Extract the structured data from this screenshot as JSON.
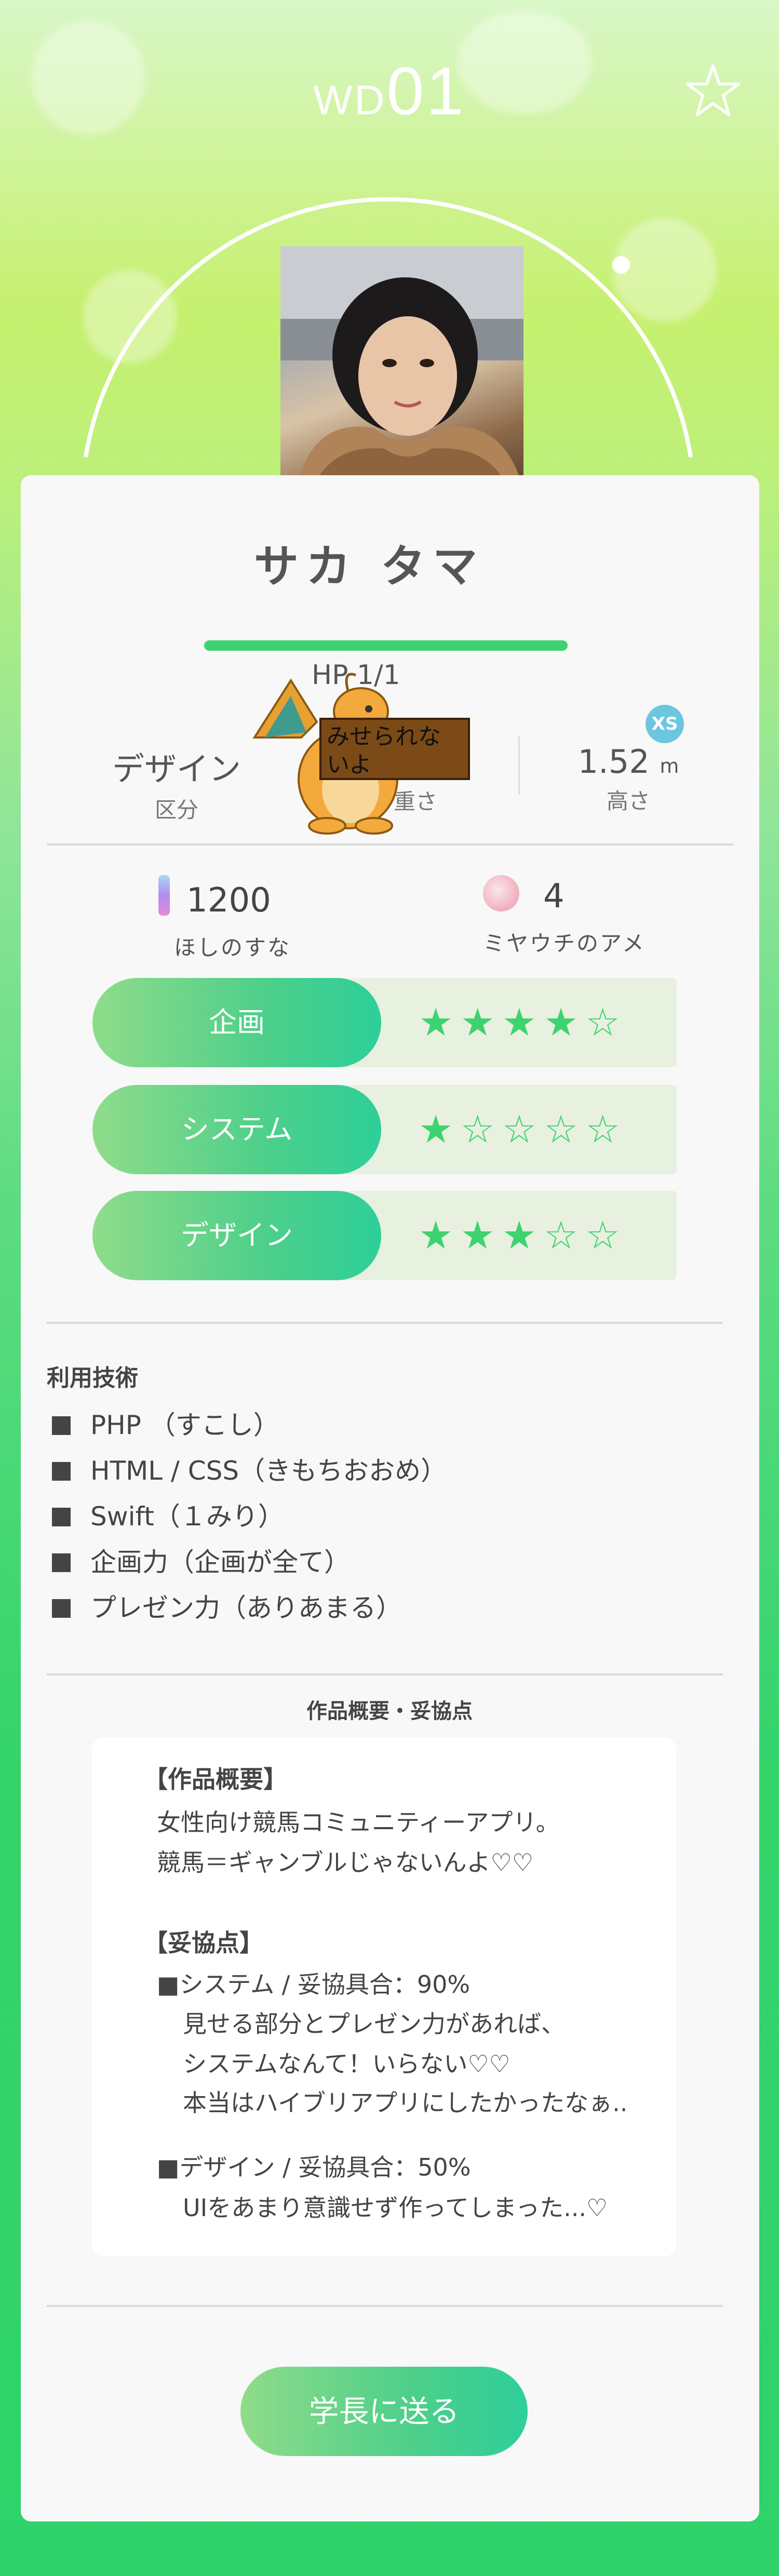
{
  "header": {
    "prefix": "WD",
    "number": "01"
  },
  "profile": {
    "name": "サカ タマ",
    "hp": "HP 1/1"
  },
  "stats": [
    {
      "value": "デザイン",
      "label": "区分"
    },
    {
      "value": "",
      "label": "重さ"
    },
    {
      "value": "1.52",
      "unit": "m",
      "label": "高さ",
      "badge": "XS"
    }
  ],
  "resources": [
    {
      "value": "1200",
      "label": "ほしのすな"
    },
    {
      "value": "4",
      "label": "ミヤウチのアメ"
    }
  ],
  "skills": [
    {
      "label": "企画",
      "rating": 4,
      "stars": "★★★★☆"
    },
    {
      "label": "システム",
      "rating": 1,
      "stars": "★☆☆☆☆"
    },
    {
      "label": "デザイン",
      "rating": 3,
      "stars": "★★★☆☆"
    }
  ],
  "tech": {
    "title": "利用技術",
    "items": [
      "PHP （すこし）",
      "HTML / CSS（きもちおおめ）",
      "Swift（１みり）",
      "企画力（企画が全て）",
      "プレゼン力（ありあまる）"
    ]
  },
  "summary": {
    "title": "作品概要・妥協点",
    "lines": [
      "【作品概要】",
      "女性向け競馬コミュニティーアプリ。",
      "競馬＝ギャンブルじゃないんよ♡♡",
      "【妥協点】",
      "■システム / 妥協具合：90%",
      "見せる部分とプレゼン力があれば、",
      "システムなんて！いらない♡♡",
      "本当はハイブリアプリにしたかったなぁ..",
      "■デザイン / 妥協具合：50%",
      "UIをあまり意識せず作ってしまった...♡"
    ]
  },
  "sticker": {
    "sign_text": "みせられないよ"
  },
  "actions": {
    "send_label": "学長に送る"
  },
  "colors": {
    "accent": "#3ed36f",
    "badge": "#6dc6e0"
  }
}
